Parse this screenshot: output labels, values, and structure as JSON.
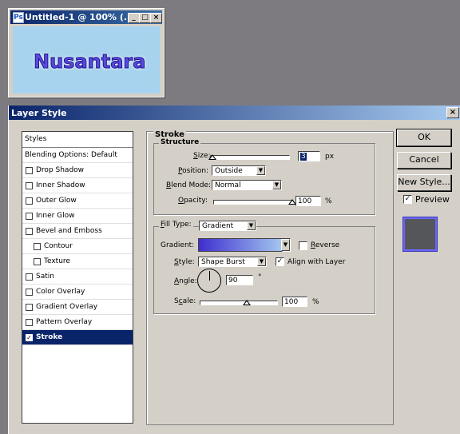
{
  "document_window": {
    "title": "Untitled-1 @ 100% (...",
    "canvas_text": "Nusantara",
    "buttons": {
      "minimize": "_",
      "maximize": "□",
      "close": "×"
    }
  },
  "dialog": {
    "title": "Layer Style",
    "close": "×",
    "styles_list": {
      "header": "Styles",
      "items": [
        {
          "label": "Blending Options: Default",
          "checkbox": false,
          "checked": false
        },
        {
          "label": "Drop Shadow",
          "checkbox": true,
          "checked": false
        },
        {
          "label": "Inner Shadow",
          "checkbox": true,
          "checked": false
        },
        {
          "label": "Outer Glow",
          "checkbox": true,
          "checked": false
        },
        {
          "label": "Inner Glow",
          "checkbox": true,
          "checked": false
        },
        {
          "label": "Bevel and Emboss",
          "checkbox": true,
          "checked": false
        },
        {
          "label": "Contour",
          "checkbox": true,
          "checked": false
        },
        {
          "label": "Texture",
          "checkbox": true,
          "checked": false
        },
        {
          "label": "Satin",
          "checkbox": true,
          "checked": false
        },
        {
          "label": "Color Overlay",
          "checkbox": true,
          "checked": false
        },
        {
          "label": "Gradient Overlay",
          "checkbox": true,
          "checked": false
        },
        {
          "label": "Pattern Overlay",
          "checkbox": true,
          "checked": false
        },
        {
          "label": "Stroke",
          "checkbox": true,
          "checked": true,
          "selected": true
        }
      ]
    },
    "stroke": {
      "title": "Stroke",
      "structure_title": "Structure",
      "size_label": "Size:",
      "size_value": "3",
      "size_unit": "px",
      "size_fraction": 0.02,
      "position_label": "Position:",
      "position_value": "Outside",
      "blend_mode_label": "Blend Mode:",
      "blend_mode_value": "Normal",
      "opacity_label": "Opacity:",
      "opacity_value": "100",
      "opacity_unit": "%",
      "opacity_fraction": 1.0,
      "fill_type_label": "Fill Type:",
      "fill_type_value": "Gradient",
      "gradient_label": "Gradient:",
      "gradient_colors": [
        "#3e2fd0",
        "#a5c8f0"
      ],
      "reverse_label": "Reverse",
      "reverse_checked": false,
      "style_label": "Style:",
      "style_value": "Shape Burst",
      "align_label": "Align with Layer",
      "align_checked": true,
      "angle_label": "Angle:",
      "angle_value": "90",
      "angle_unit": "°",
      "scale_label": "Scale:",
      "scale_value": "100",
      "scale_unit": "%",
      "scale_fraction": 0.6
    },
    "buttons": {
      "ok": "OK",
      "cancel": "Cancel",
      "new_style": "New Style...",
      "preview_label": "Preview",
      "preview_checked": true
    }
  },
  "colors": {
    "title_bar": "#0a246a",
    "selection": "#0a246a",
    "preview_swatch": "#55565a",
    "preview_border": "#6b66ff"
  }
}
